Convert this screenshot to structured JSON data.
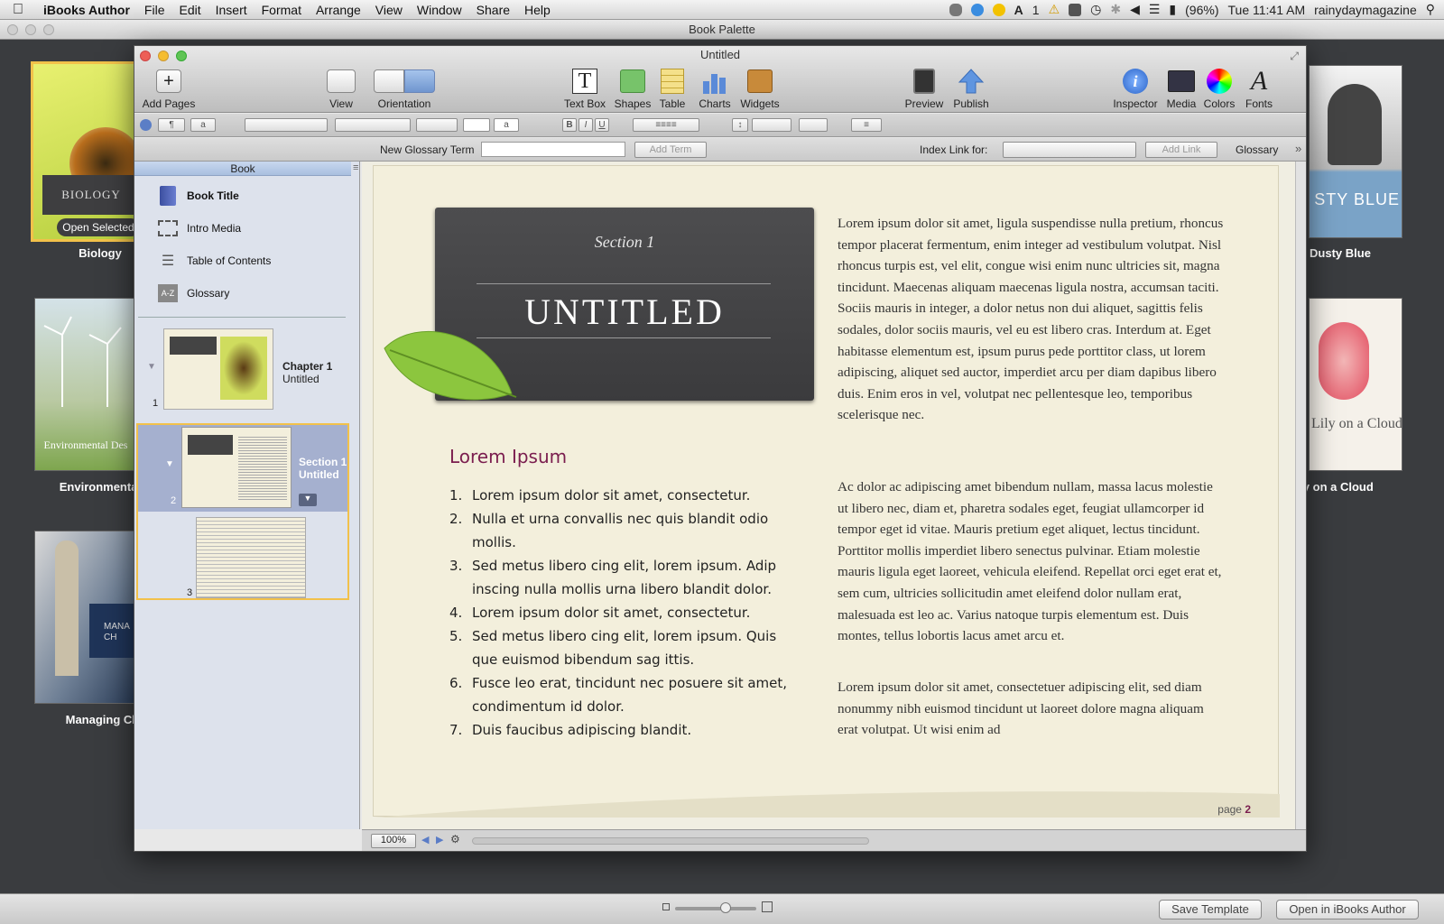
{
  "menubar": {
    "app": "iBooks Author",
    "items": [
      "File",
      "Edit",
      "Insert",
      "Format",
      "Arrange",
      "View",
      "Window",
      "Share",
      "Help"
    ],
    "battery": "(96%)",
    "clock": "Tue 11:41 AM",
    "user": "rainydaymagazine",
    "adobe_count": "1"
  },
  "palette": {
    "title": "Book Palette",
    "templates": [
      {
        "label": "Biology",
        "cover_title": "BIOLOGY",
        "action": "Open Selected"
      },
      {
        "label": "Environmental De",
        "cover_title": "Environmental Des"
      },
      {
        "label": "Managing Chan",
        "cover_title": "MANA CH"
      },
      {
        "label": "Dusty Blue",
        "cover_title": "STY BLUE"
      },
      {
        "label": "ly on a Cloud",
        "cover_title": "Lily on a Cloud"
      }
    ],
    "save_template": "Save Template",
    "open_in": "Open in iBooks Author"
  },
  "window": {
    "title": "Untitled",
    "toolbar": {
      "add_pages": "Add Pages",
      "view": "View",
      "orientation": "Orientation",
      "text_box": "Text Box",
      "shapes": "Shapes",
      "table": "Table",
      "charts": "Charts",
      "widgets": "Widgets",
      "preview": "Preview",
      "publish": "Publish",
      "inspector": "Inspector",
      "media": "Media",
      "colors": "Colors",
      "fonts": "Fonts"
    },
    "format": {
      "bold": "B",
      "italic": "I",
      "underline": "U",
      "char": "a"
    },
    "glossary_bar": {
      "new_term_label": "New Glossary Term",
      "add_term": "Add Term",
      "index_link_label": "Index Link for:",
      "add_link": "Add Link",
      "glossary": "Glossary"
    },
    "sidebar": {
      "header": "Book",
      "items": [
        "Book Title",
        "Intro Media",
        "Table of Contents",
        "Glossary"
      ],
      "chapter": {
        "number": "1",
        "title": "Chapter 1",
        "subtitle": "Untitled"
      },
      "section": {
        "number": "2",
        "title": "Section 1",
        "subtitle": "Untitled"
      },
      "page3": {
        "number": "3"
      }
    },
    "page": {
      "section_label": "Section 1",
      "title": "UNTITLED",
      "heading": "Lorem Ipsum",
      "list": [
        "Lorem ipsum dolor sit amet, consectetur.",
        "Nulla et urna convallis nec quis blandit odio mollis.",
        "Sed metus libero cing elit, lorem ipsum. Adip inscing nulla mollis urna libero blandit dolor.",
        "Lorem ipsum dolor sit amet, consectetur.",
        "Sed metus libero cing elit, lorem ipsum. Quis que euismod bibendum sag ittis.",
        "Fusce leo erat, tincidunt nec posuere sit amet, condimentum id dolor.",
        "Duis faucibus adipiscing blandit."
      ],
      "para1": "Lorem ipsum dolor sit amet, ligula suspendisse nulla pretium, rhoncus tempor placerat fermentum, enim integer ad vestibulum volutpat. Nisl rhoncus turpis est, vel elit, congue wisi enim nunc ultricies sit, magna tincidunt. Maecenas aliquam maecenas ligula nostra, accumsan taciti. Sociis mauris in integer, a dolor netus non dui aliquet, sagittis felis sodales, dolor sociis mauris, vel eu est libero cras. Interdum at. Eget habitasse elementum est, ipsum purus pede porttitor class, ut lorem adipiscing, aliquet sed auctor, imperdiet arcu per diam dapibus libero duis. Enim eros in vel, volutpat nec pellentesque leo, temporibus scelerisque nec.",
      "para2": "Ac dolor ac adipiscing amet bibendum nullam, massa lacus molestie ut libero nec, diam et, pharetra sodales eget, feugiat ullamcorper id tempor eget id vitae. Mauris pretium eget aliquet, lectus tincidunt. Porttitor mollis imperdiet libero senectus pulvinar. Etiam molestie mauris ligula eget laoreet, vehicula eleifend. Repellat orci eget erat et, sem cum, ultricies sollicitudin amet eleifend dolor nullam erat, malesuada est leo ac. Varius natoque turpis elementum est. Duis montes, tellus lobortis lacus amet arcu et.",
      "para3": "Lorem ipsum dolor sit amet, consectetuer adipiscing elit, sed diam nonummy nibh euismod tincidunt ut laoreet dolore magna aliquam erat volutpat.  Ut wisi enim ad",
      "page_label": "page",
      "page_number": "2"
    },
    "status": {
      "zoom": "100%"
    }
  },
  "colors": {
    "heading": "#7a1d4e",
    "accent": "#f2c14a",
    "selection": "#a5b0cf"
  }
}
